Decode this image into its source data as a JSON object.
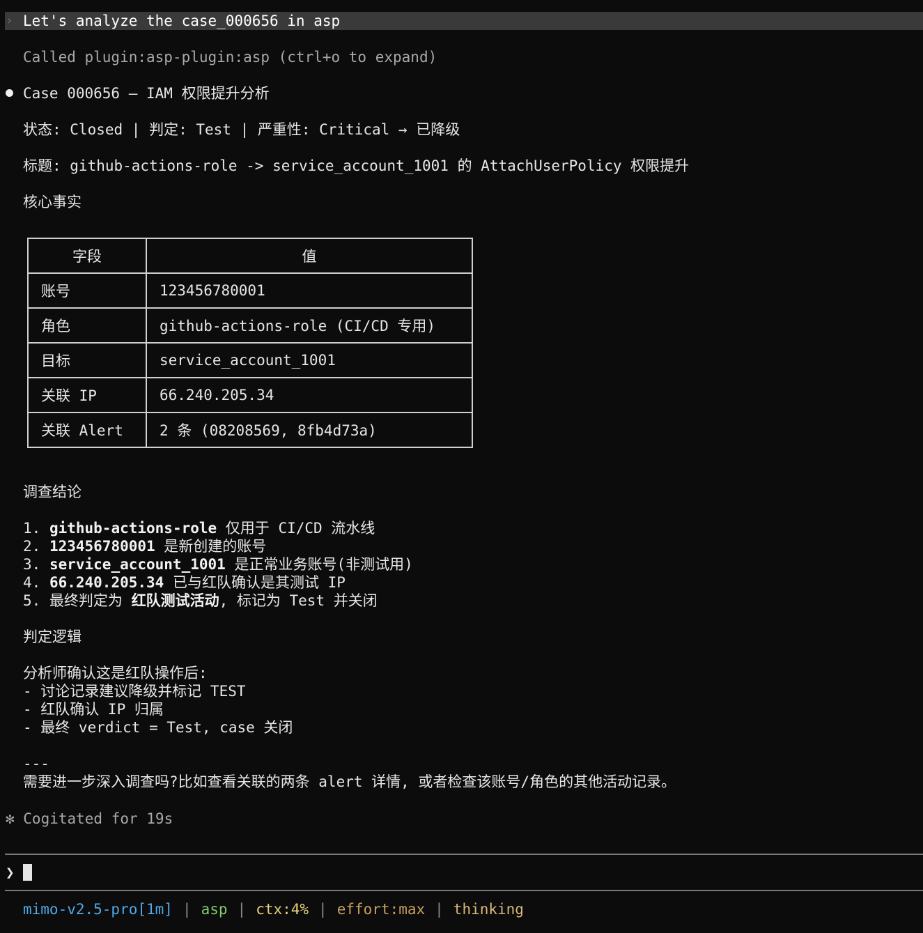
{
  "prompt": {
    "chevron": "›",
    "text": "Let's analyze the case_000656 in asp"
  },
  "tool_call": "Called plugin:asp-plugin:asp (ctrl+o to expand)",
  "response": {
    "heading": "Case 000656 — IAM 权限提升分析",
    "status_line": "状态: Closed | 判定: Test | 严重性: Critical → 已降级",
    "title_line": "标题: github-actions-role -> service_account_1001 的 AttachUserPolicy 权限提升",
    "facts_heading": "核心事实",
    "facts_table": {
      "headers": [
        "字段",
        "值"
      ],
      "rows": [
        [
          "账号",
          "123456780001"
        ],
        [
          "角色",
          "github-actions-role (CI/CD 专用)"
        ],
        [
          "目标",
          "service_account_1001"
        ],
        [
          "关联 IP",
          "66.240.205.34"
        ],
        [
          "关联 Alert",
          "2 条 (08208569, 8fb4d73a)"
        ]
      ]
    },
    "conclusion_heading": "调查结论",
    "conclusions": [
      {
        "num": "1. ",
        "bold": "github-actions-role",
        "rest": " 仅用于 CI/CD 流水线"
      },
      {
        "num": "2. ",
        "bold": "123456780001",
        "rest": " 是新创建的账号"
      },
      {
        "num": "3. ",
        "bold": "service_account_1001",
        "rest": " 是正常业务账号(非测试用)"
      },
      {
        "num": "4. ",
        "bold": "66.240.205.34",
        "rest": " 已与红队确认是其测试 IP"
      },
      {
        "num": "5. ",
        "pre": "最终判定为 ",
        "bold": "红队测试活动",
        "rest": ", 标记为 Test 并关闭"
      }
    ],
    "logic_heading": "判定逻辑",
    "logic_lines": [
      "分析师确认这是红队操作后:",
      "- 讨论记录建议降级并标记 TEST",
      "- 红队确认 IP 归属",
      "- 最终 verdict = Test, case 关闭"
    ],
    "rule": "---",
    "followup": "需要进一步深入调查吗?比如查看关联的两条 alert 详情, 或者检查该账号/角色的其他活动记录。"
  },
  "thinking_time": "✻ Cogitated for 19s",
  "input": {
    "chevron": "❯",
    "value": ""
  },
  "status_bar": {
    "model": "mimo-v2.5-pro[1m]",
    "plugin": "asp",
    "ctx": "ctx:4%",
    "effort": "effort:max",
    "mode": "thinking"
  }
}
